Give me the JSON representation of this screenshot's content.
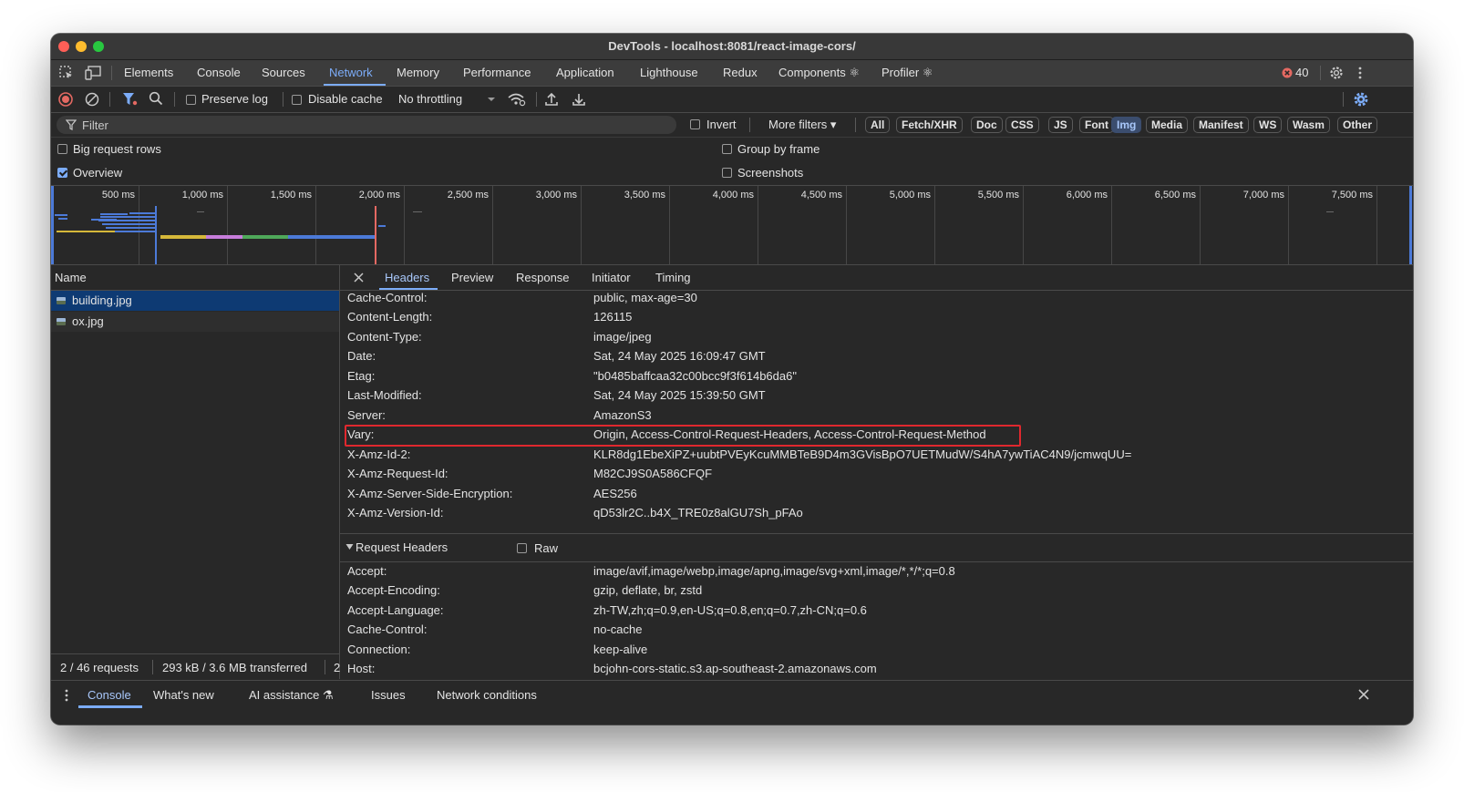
{
  "window": {
    "title": "DevTools - localhost:8081/react-image-cors/"
  },
  "panel_tabs": [
    {
      "label": "Elements"
    },
    {
      "label": "Console"
    },
    {
      "label": "Sources"
    },
    {
      "label": "Network",
      "active": true
    },
    {
      "label": "Memory"
    },
    {
      "label": "Performance"
    },
    {
      "label": "Application"
    },
    {
      "label": "Lighthouse"
    },
    {
      "label": "Redux"
    },
    {
      "label": "Components ⚛"
    },
    {
      "label": "Profiler ⚛"
    }
  ],
  "error_count": "40",
  "toolbar": {
    "preserve_log": "Preserve log",
    "disable_cache": "Disable cache",
    "throttling": "No throttling"
  },
  "filterbar": {
    "placeholder": "Filter",
    "invert": "Invert",
    "more_filters": "More filters ▾",
    "chips": [
      {
        "label": "All"
      },
      {
        "label": "Fetch/XHR"
      },
      {
        "label": "Doc"
      },
      {
        "label": "CSS"
      },
      {
        "label": "JS"
      },
      {
        "label": "Font"
      },
      {
        "label": "Img",
        "active": true
      },
      {
        "label": "Media"
      },
      {
        "label": "Manifest"
      },
      {
        "label": "WS"
      },
      {
        "label": "Wasm"
      },
      {
        "label": "Other"
      }
    ]
  },
  "options": {
    "big_request_rows": "Big request rows",
    "overview": "Overview",
    "group_by_frame": "Group by frame",
    "screenshots": "Screenshots"
  },
  "overview": {
    "ticks": [
      "500 ms",
      "1,000 ms",
      "1,500 ms",
      "2,000 ms",
      "2,500 ms",
      "3,000 ms",
      "3,500 ms",
      "4,000 ms",
      "4,500 ms",
      "5,000 ms",
      "5,500 ms",
      "6,000 ms",
      "6,500 ms",
      "7,000 ms",
      "7,500 ms"
    ]
  },
  "request_list": {
    "header": "Name",
    "rows": [
      {
        "name": "building.jpg",
        "selected": true
      },
      {
        "name": "ox.jpg"
      }
    ],
    "status": {
      "requests": "2 / 46 requests",
      "transferred": "293 kB / 3.6 MB transferred",
      "cut": "2"
    }
  },
  "details": {
    "tabs": [
      {
        "label": "Headers",
        "active": true
      },
      {
        "label": "Preview"
      },
      {
        "label": "Response"
      },
      {
        "label": "Initiator"
      },
      {
        "label": "Timing"
      }
    ],
    "response_headers": [
      {
        "key": "Cache-Control:",
        "value": "public, max-age=30"
      },
      {
        "key": "Content-Length:",
        "value": "126115"
      },
      {
        "key": "Content-Type:",
        "value": "image/jpeg"
      },
      {
        "key": "Date:",
        "value": "Sat, 24 May 2025 16:09:47 GMT"
      },
      {
        "key": "Etag:",
        "value": "\"b0485baffcaa32c00bcc9f3f614b6da6\""
      },
      {
        "key": "Last-Modified:",
        "value": "Sat, 24 May 2025 15:39:50 GMT"
      },
      {
        "key": "Server:",
        "value": "AmazonS3"
      },
      {
        "key": "Vary:",
        "value": "Origin, Access-Control-Request-Headers, Access-Control-Request-Method",
        "highlighted": true
      },
      {
        "key": "X-Amz-Id-2:",
        "value": "KLR8dg1EbeXiPZ+uubtPVEyKcuMMBTeB9D4m3GVisBpO7UETMudW/S4hA7ywTiAC4N9/jcmwqUU="
      },
      {
        "key": "X-Amz-Request-Id:",
        "value": "M82CJ9S0A586CFQF"
      },
      {
        "key": "X-Amz-Server-Side-Encryption:",
        "value": "AES256"
      },
      {
        "key": "X-Amz-Version-Id:",
        "value": "qD53lr2C..b4X_TRE0z8alGU7Sh_pFAo"
      }
    ],
    "request_section": {
      "title": "Request Headers",
      "raw": "Raw"
    },
    "request_headers": [
      {
        "key": "Accept:",
        "value": "image/avif,image/webp,image/apng,image/svg+xml,image/*,*/*;q=0.8"
      },
      {
        "key": "Accept-Encoding:",
        "value": "gzip, deflate, br, zstd"
      },
      {
        "key": "Accept-Language:",
        "value": "zh-TW,zh;q=0.9,en-US;q=0.8,en;q=0.7,zh-CN;q=0.6"
      },
      {
        "key": "Cache-Control:",
        "value": "no-cache"
      },
      {
        "key": "Connection:",
        "value": "keep-alive"
      },
      {
        "key": "Host:",
        "value": "bcjohn-cors-static.s3.ap-southeast-2.amazonaws.com"
      }
    ]
  },
  "drawer": {
    "tabs": [
      {
        "label": "Console",
        "active": true
      },
      {
        "label": "What's new"
      },
      {
        "label": "AI assistance ⚗"
      },
      {
        "label": "Issues"
      },
      {
        "label": "Network conditions"
      }
    ]
  }
}
